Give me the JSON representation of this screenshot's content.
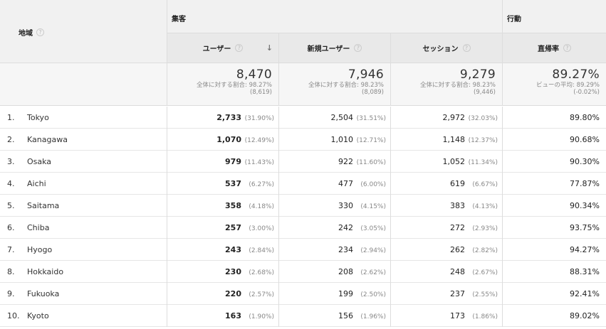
{
  "header": {
    "region_label": "地域",
    "group_acquisition": "集客",
    "group_behavior": "行動",
    "columns": {
      "users": "ユーザー",
      "new_users": "新規ユーザー",
      "sessions": "セッション",
      "bounce_rate": "直帰率"
    },
    "help_glyph": "?",
    "sort_glyph": "↓"
  },
  "totals": {
    "users": {
      "value": "8,470",
      "line1": "全体に対する割合: 98.27%",
      "line2": "(8,619)"
    },
    "new_users": {
      "value": "7,946",
      "line1": "全体に対する割合: 98.23%",
      "line2": "(8,089)"
    },
    "sessions": {
      "value": "9,279",
      "line1": "全体に対する割合: 98.23%",
      "line2": "(9,446)"
    },
    "bounce_rate": {
      "value": "89.27%",
      "line1": "ビューの平均: 89.29%",
      "line2": "(-0.02%)"
    }
  },
  "rows": [
    {
      "num": "1.",
      "region": "Tokyo",
      "users": "2,733",
      "users_pct": "(31.90%)",
      "new_users": "2,504",
      "new_users_pct": "(31.51%)",
      "sessions": "2,972",
      "sessions_pct": "(32.03%)",
      "bounce": "89.80%"
    },
    {
      "num": "2.",
      "region": "Kanagawa",
      "users": "1,070",
      "users_pct": "(12.49%)",
      "new_users": "1,010",
      "new_users_pct": "(12.71%)",
      "sessions": "1,148",
      "sessions_pct": "(12.37%)",
      "bounce": "90.68%"
    },
    {
      "num": "3.",
      "region": "Osaka",
      "users": "979",
      "users_pct": "(11.43%)",
      "new_users": "922",
      "new_users_pct": "(11.60%)",
      "sessions": "1,052",
      "sessions_pct": "(11.34%)",
      "bounce": "90.30%"
    },
    {
      "num": "4.",
      "region": "Aichi",
      "users": "537",
      "users_pct": "(6.27%)",
      "new_users": "477",
      "new_users_pct": "(6.00%)",
      "sessions": "619",
      "sessions_pct": "(6.67%)",
      "bounce": "77.87%"
    },
    {
      "num": "5.",
      "region": "Saitama",
      "users": "358",
      "users_pct": "(4.18%)",
      "new_users": "330",
      "new_users_pct": "(4.15%)",
      "sessions": "383",
      "sessions_pct": "(4.13%)",
      "bounce": "90.34%"
    },
    {
      "num": "6.",
      "region": "Chiba",
      "users": "257",
      "users_pct": "(3.00%)",
      "new_users": "242",
      "new_users_pct": "(3.05%)",
      "sessions": "272",
      "sessions_pct": "(2.93%)",
      "bounce": "93.75%"
    },
    {
      "num": "7.",
      "region": "Hyogo",
      "users": "243",
      "users_pct": "(2.84%)",
      "new_users": "234",
      "new_users_pct": "(2.94%)",
      "sessions": "262",
      "sessions_pct": "(2.82%)",
      "bounce": "94.27%"
    },
    {
      "num": "8.",
      "region": "Hokkaido",
      "users": "230",
      "users_pct": "(2.68%)",
      "new_users": "208",
      "new_users_pct": "(2.62%)",
      "sessions": "248",
      "sessions_pct": "(2.67%)",
      "bounce": "88.31%"
    },
    {
      "num": "9.",
      "region": "Fukuoka",
      "users": "220",
      "users_pct": "(2.57%)",
      "new_users": "199",
      "new_users_pct": "(2.50%)",
      "sessions": "237",
      "sessions_pct": "(2.55%)",
      "bounce": "92.41%"
    },
    {
      "num": "10.",
      "region": "Kyoto",
      "users": "163",
      "users_pct": "(1.90%)",
      "new_users": "156",
      "new_users_pct": "(1.96%)",
      "sessions": "173",
      "sessions_pct": "(1.86%)",
      "bounce": "89.02%"
    }
  ]
}
